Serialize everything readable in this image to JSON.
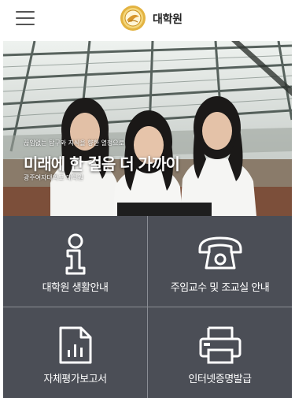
{
  "header": {
    "menu_icon": "hamburger-menu-icon",
    "logo_icon": "university-seal-icon",
    "title": "대학원"
  },
  "hero": {
    "subtitle": "끊임없는 탐구와 지식을 향한 열정으로",
    "headline": "미래에 한 걸음 더 가까이",
    "university": "광주여자대학교 대학원"
  },
  "tiles": [
    {
      "label": "대학원 생활안내",
      "icon": "info-icon"
    },
    {
      "label": "주임교수 및 조교실 안내",
      "icon": "telephone-icon"
    },
    {
      "label": "자체평가보고서",
      "icon": "report-chart-icon"
    },
    {
      "label": "인터넷증명발급",
      "icon": "printer-icon"
    }
  ],
  "colors": {
    "tile_bg": "#4b4e56",
    "divider": "#8a8d94",
    "logo_gold": "#d9a431"
  }
}
